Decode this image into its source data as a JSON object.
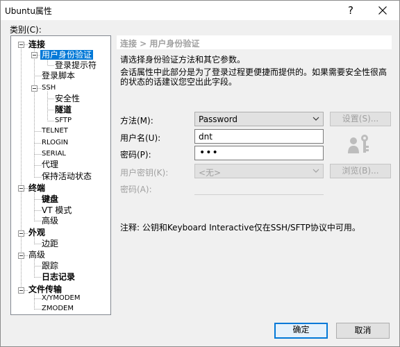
{
  "window": {
    "title": "Ubuntu属性",
    "help_label": "?"
  },
  "category_label": "类别(C):",
  "tree": {
    "connection": "连接",
    "user_auth": "用户身份验证",
    "login_prompts": "登录提示符",
    "login_script": "登录脚本",
    "ssh": "SSH",
    "security": "安全性",
    "tunnel": "隧道",
    "sftp": "SFTP",
    "telnet": "TELNET",
    "rlogin": "RLOGIN",
    "serial": "SERIAL",
    "proxy": "代理",
    "keepalive": "保持活动状态",
    "terminal": "终端",
    "keyboard": "键盘",
    "vt_mode": "VT 模式",
    "advanced1": "高级",
    "appearance": "外观",
    "margin": "边距",
    "advanced2": "高级",
    "trace": "跟踪",
    "logging": "日志记录",
    "file_transfer": "文件传输",
    "xymodem": "X/YMODEM",
    "zmodem": "ZMODEM"
  },
  "content": {
    "header": "连接 > 用户身份验证",
    "desc1": "请选择身份验证方法和其它参数。",
    "desc2": "会话属性中此部分是为了登录过程更便捷而提供的。如果需要安全性很高",
    "desc3": "的状态的话建议您空出此字段。",
    "method_label": "方法(M):",
    "method_value": "Password",
    "settings_button": "设置(S)...",
    "username_label": "用户名(U):",
    "username_value": "dnt",
    "password_label": "密码(P):",
    "password_value": "•••",
    "userkey_label": "用户密钥(K):",
    "userkey_value": "<无>",
    "browse_button": "浏览(B)...",
    "passphrase_label": "密码(A):",
    "note": "注释: 公钥和Keyboard Interactive仅在SSH/SFTP协议中可用。"
  },
  "buttons": {
    "ok": "确定",
    "cancel": "取消"
  },
  "colors": {
    "selection": "#0078d7",
    "disabled_text": "#a0a0a0"
  }
}
